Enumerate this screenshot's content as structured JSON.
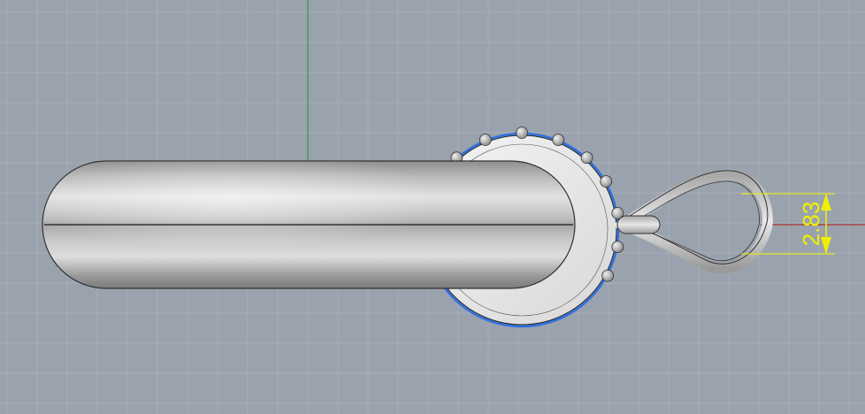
{
  "viewport": {
    "background": "#9aa3ad",
    "grid_color": "#a7afb8",
    "axis_y_color": "#2f9e2f",
    "axis_x_color": "#b03030"
  },
  "model": {
    "body_color": "#c4c4c4",
    "disc_color": "#ececec",
    "selection_color": "#2f6fe0"
  },
  "dimension": {
    "value": "2.83",
    "color": "#f0f000"
  }
}
